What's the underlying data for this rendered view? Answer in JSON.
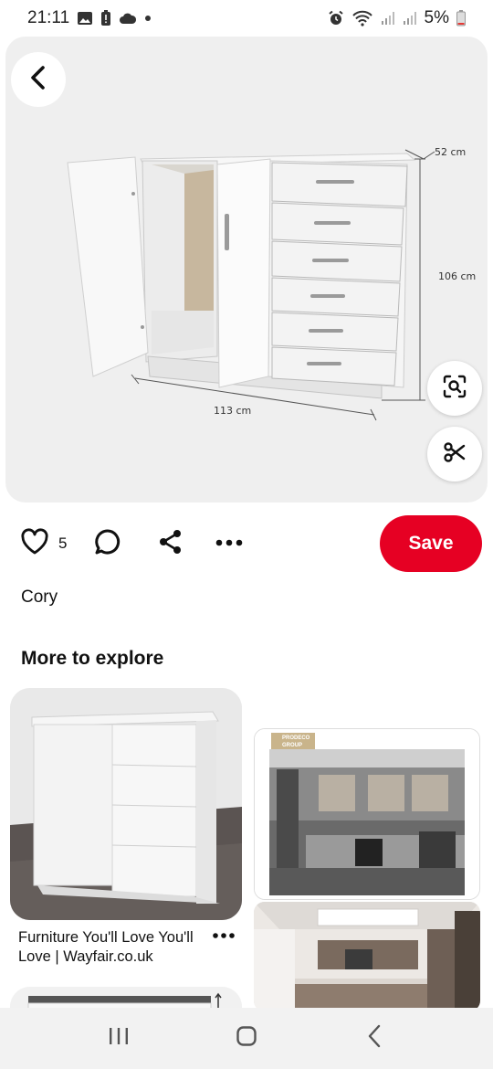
{
  "status_bar": {
    "time": "21:11",
    "battery": "5%",
    "left_icons": [
      "image-icon",
      "battery-alert-icon",
      "cloud-icon",
      "dot-icon"
    ],
    "right_icons": [
      "alarm-icon",
      "wifi-icon",
      "signal-icon",
      "signal-icon",
      "battery-icon"
    ]
  },
  "hero": {
    "dims": {
      "depth": "52 cm",
      "height": "106 cm",
      "width": "113 cm"
    },
    "buttons": [
      "back-icon",
      "visual-search-icon",
      "scissors-icon"
    ]
  },
  "actions": {
    "like_count": "5",
    "save_label": "Save",
    "icons": [
      "heart-icon",
      "comment-icon",
      "share-icon",
      "more-icon"
    ]
  },
  "creator": {
    "name": "Cory"
  },
  "explore": {
    "title": "More to explore",
    "pins": [
      {
        "title": "Furniture You'll Love You'll Love | Wayfair.co.uk"
      },
      {
        "logo_text": "PRODECO GROUP"
      }
    ]
  },
  "colors": {
    "save_red": "#e60023",
    "hero_bg": "#efefef"
  },
  "nav_bar": {
    "icons": [
      "recents-icon",
      "home-icon",
      "back-nav-icon"
    ]
  }
}
